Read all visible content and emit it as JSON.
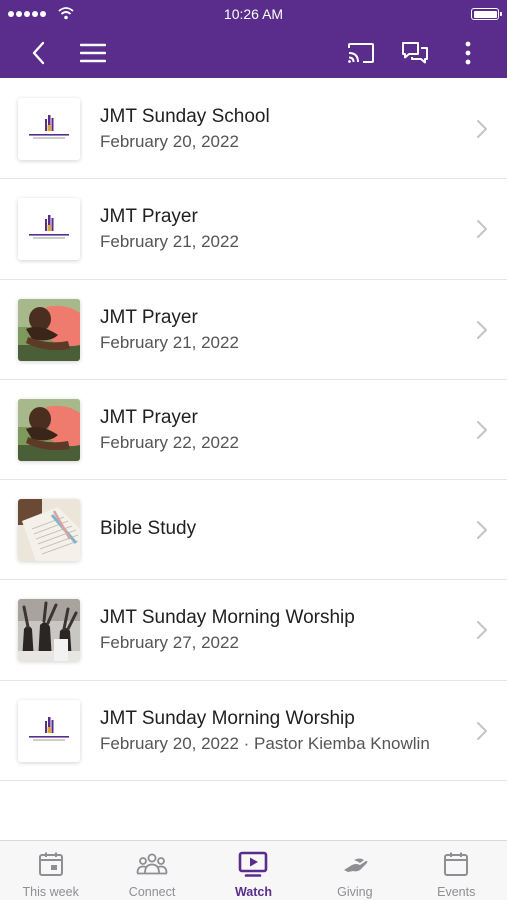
{
  "colors": {
    "brand": "#5a2d8c",
    "text": "#1f1f1f",
    "subtext": "#555555",
    "tab_inactive": "#8e8e93"
  },
  "status_bar": {
    "time": "10:26 AM"
  },
  "nav": {
    "back_icon": "chevron-left-icon",
    "menu_icon": "hamburger-icon",
    "cast_icon": "cast-icon",
    "chat_icon": "chat-bubbles-icon",
    "more_icon": "more-vertical-icon"
  },
  "items": [
    {
      "title": "JMT Sunday School",
      "subtitle": "February 20, 2022",
      "thumb": "church-logo"
    },
    {
      "title": "JMT Prayer",
      "subtitle": "February 21, 2022",
      "thumb": "church-logo"
    },
    {
      "title": "JMT Prayer",
      "subtitle": "February 21, 2022",
      "thumb": "praying-man-photo"
    },
    {
      "title": "JMT Prayer",
      "subtitle": "February 22, 2022",
      "thumb": "praying-man-photo"
    },
    {
      "title": "Bible Study",
      "subtitle": "",
      "thumb": "bible-photo"
    },
    {
      "title": "JMT Sunday Morning Worship",
      "subtitle": "February 27, 2022",
      "thumb": "worship-photo"
    },
    {
      "title": "JMT Sunday Morning Worship",
      "subtitle": "February 20, 2022 · Pastor Kiemba Knowlin",
      "thumb": "church-logo"
    }
  ],
  "tabs": [
    {
      "label": "This week",
      "icon": "calendar-today-icon",
      "active": false
    },
    {
      "label": "Connect",
      "icon": "people-icon",
      "active": false
    },
    {
      "label": "Watch",
      "icon": "video-icon",
      "active": true
    },
    {
      "label": "Giving",
      "icon": "giving-hand-icon",
      "active": false
    },
    {
      "label": "Events",
      "icon": "calendar-icon",
      "active": false
    }
  ]
}
